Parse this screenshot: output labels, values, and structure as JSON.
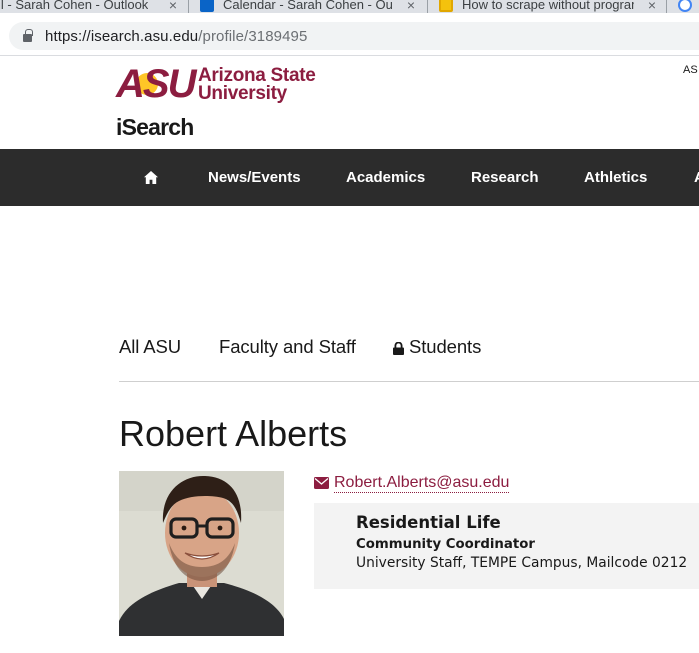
{
  "browser": {
    "tabs": [
      {
        "title": "il - Sarah Cohen - Outlook"
      },
      {
        "title": "Calendar - Sarah Cohen - Outlo"
      },
      {
        "title": "How to scrape without program"
      }
    ],
    "url_host": "https://isearch.asu.edu",
    "url_path": "/profile/3189495"
  },
  "header": {
    "logo_mark": "ASU",
    "logo_name_line1": "Arizona State",
    "logo_name_line2": "University",
    "site_title": "iSearch",
    "global_link": "AS"
  },
  "nav": {
    "items": [
      {
        "label": "News/Events"
      },
      {
        "label": "Academics"
      },
      {
        "label": "Research"
      },
      {
        "label": "Athletics"
      },
      {
        "label": "A"
      }
    ]
  },
  "directory_tabs": [
    {
      "label": "All ASU"
    },
    {
      "label": "Faculty and Staff"
    },
    {
      "label": "Students"
    }
  ],
  "profile": {
    "name": "Robert Alberts",
    "email": "Robert.Alberts@asu.edu",
    "department": "Residential Life",
    "title": "Community Coordinator",
    "details": "University Staff, TEMPE Campus, Mailcode 0212"
  },
  "colors": {
    "asu_maroon": "#8c1d40",
    "asu_gold": "#ffc627",
    "nav_background": "#2c2c2c",
    "affiliation_background": "#f3f3f3"
  }
}
